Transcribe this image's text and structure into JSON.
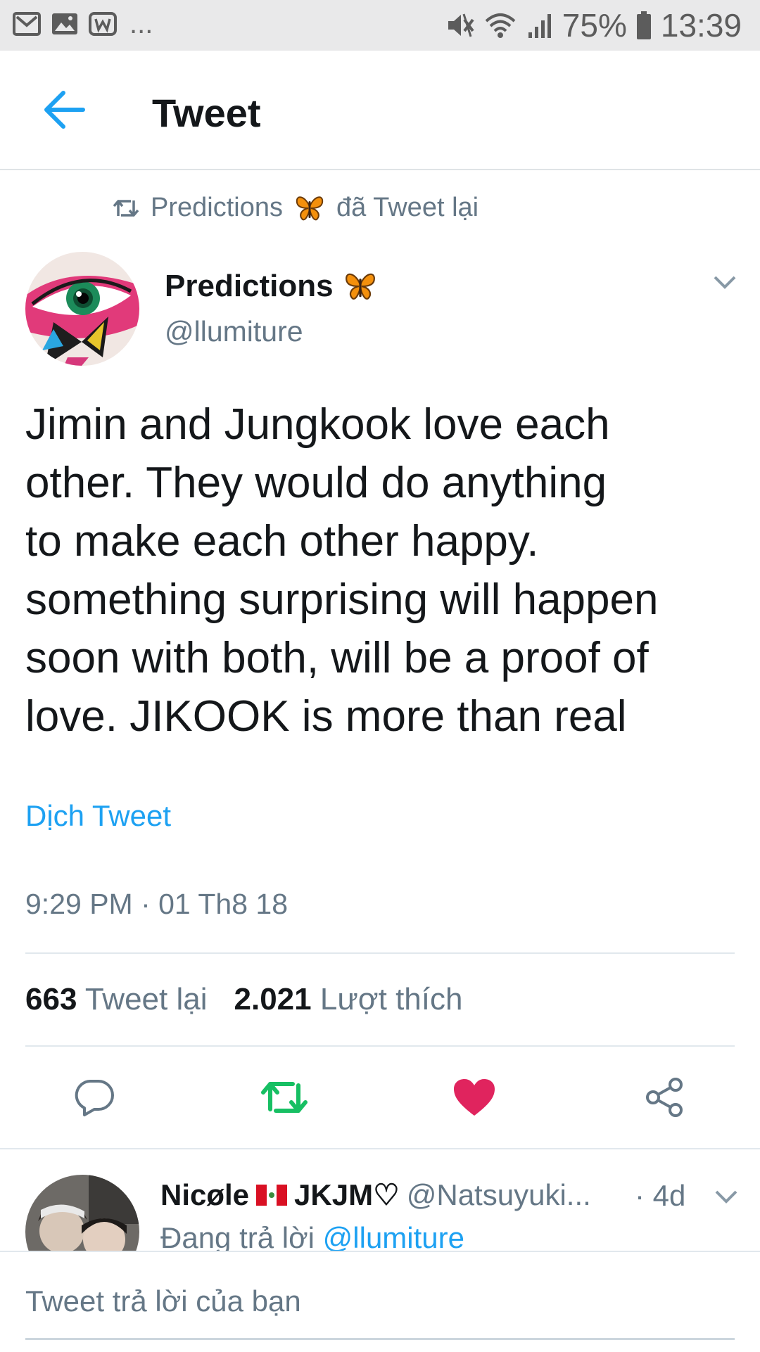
{
  "status_bar": {
    "notification_icons": [
      "gmail-icon",
      "gallery-icon",
      "app-w-icon"
    ],
    "more": "...",
    "battery": "75%",
    "time": "13:39"
  },
  "header": {
    "title": "Tweet"
  },
  "retweet_context": {
    "user": "Predictions",
    "suffix": "đã Tweet lại"
  },
  "tweet": {
    "author_name": "Predictions",
    "author_handle": "@llumiture",
    "lines": [
      "Jimin and Jungkook love each",
      "other. They would do anything",
      "to make each other happy.",
      "something surprising will happen",
      "soon with both, will be a proof of",
      "love. JIKOOK is more than real"
    ],
    "translate_label": "Dịch Tweet",
    "timestamp": "9:29 PM · 01 Th8 18",
    "retweets_count": "663",
    "retweets_label": "Tweet lại",
    "likes_count": "2.021",
    "likes_label": "Lượt thích"
  },
  "colors": {
    "accent": "#1da1f2",
    "retweet_green": "#17bf63",
    "like_red": "#e0245e",
    "secondary_text": "#657786"
  },
  "reply": {
    "name_part1": "Nicøle",
    "name_part2": "JKJM♡",
    "handle": "@Natsuyuki...",
    "time": "· 4d",
    "replying_to_label": "Đang trả lời",
    "replying_to_mention": "@llumiture"
  },
  "compose": {
    "placeholder": "Tweet trả lời của bạn"
  }
}
